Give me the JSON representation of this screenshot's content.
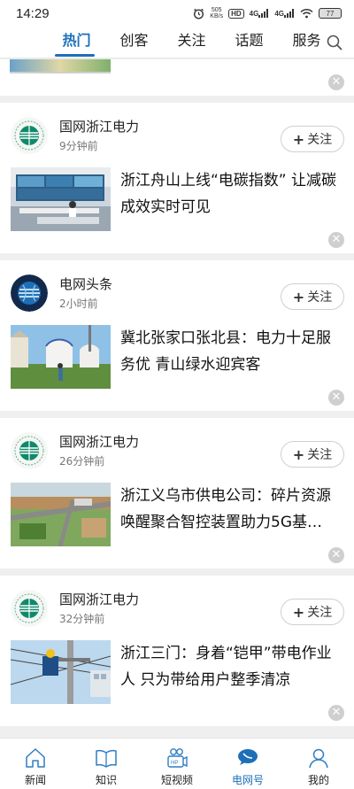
{
  "status_bar": {
    "time": "14:29",
    "net_speed": "505",
    "net_unit": "KB/s",
    "hd": "HD",
    "sig1": "4G",
    "sig2": "4G",
    "battery": "77"
  },
  "top_nav": {
    "tabs": [
      {
        "label": "热门",
        "active": true
      },
      {
        "label": "创客",
        "active": false
      },
      {
        "label": "关注",
        "active": false
      },
      {
        "label": "话题",
        "active": false
      },
      {
        "label": "服务",
        "active": false
      }
    ]
  },
  "feed": [
    {
      "source": "国网浙江电力",
      "time": "9分钟前",
      "follow": "关注",
      "title": "浙江舟山上线“电碳指数” 让减碳成效实时可见",
      "logo": "sgcc-logo",
      "thumb": "control-room-photo"
    },
    {
      "source": "电网头条",
      "time": "2小时前",
      "follow": "关注",
      "title": "冀北张家口张北县：电力十足服务优 青山绿水迎宾客",
      "logo": "grid-headline-logo",
      "thumb": "yurt-grassland-photo"
    },
    {
      "source": "国网浙江电力",
      "time": "26分钟前",
      "follow": "关注",
      "title": "浙江义乌市供电公司：碎片资源唤醒聚合智控装置助力5G基…",
      "logo": "sgcc-logo",
      "thumb": "aerial-road-photo"
    },
    {
      "source": "国网浙江电力",
      "time": "32分钟前",
      "follow": "关注",
      "title": "浙江三门：身着“铠甲”带电作业人 只为带给用户整季清凉",
      "logo": "sgcc-logo",
      "thumb": "lineman-pole-photo"
    }
  ],
  "bottom_nav": [
    {
      "label": "新闻",
      "icon": "home-icon",
      "active": false
    },
    {
      "label": "知识",
      "icon": "book-icon",
      "active": false
    },
    {
      "label": "短视频",
      "icon": "video-camera-icon",
      "active": false
    },
    {
      "label": "电网号",
      "icon": "grid-account-icon",
      "active": true
    },
    {
      "label": "我的",
      "icon": "person-icon",
      "active": false
    }
  ],
  "colors": {
    "accent": "#1d6fb8",
    "background": "#efefef"
  }
}
